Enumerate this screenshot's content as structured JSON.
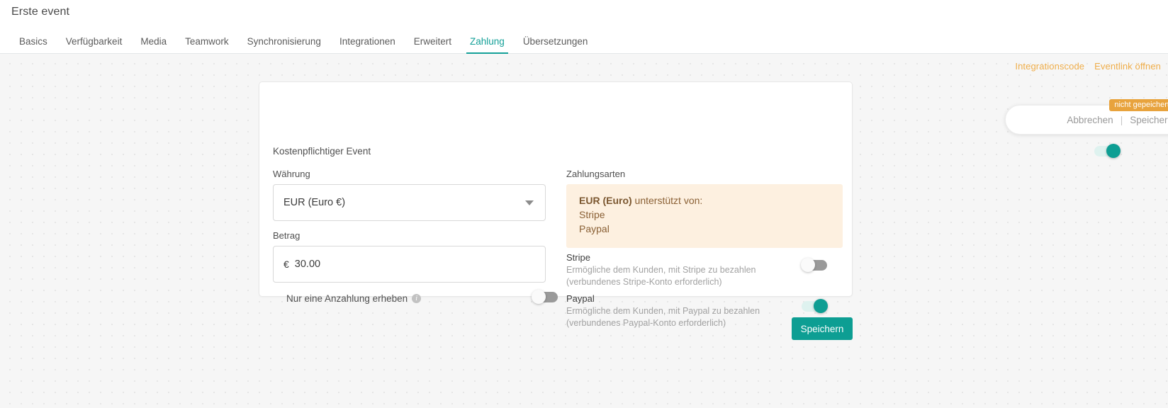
{
  "header": {
    "title": "Erste event",
    "tabs": [
      {
        "label": "Basics",
        "active": false
      },
      {
        "label": "Verfügbarkeit",
        "active": false
      },
      {
        "label": "Media",
        "active": false
      },
      {
        "label": "Teamwork",
        "active": false
      },
      {
        "label": "Synchronisierung",
        "active": false
      },
      {
        "label": "Integrationen",
        "active": false
      },
      {
        "label": "Erweitert",
        "active": false
      },
      {
        "label": "Zahlung",
        "active": true
      },
      {
        "label": "Übersetzungen",
        "active": false
      }
    ]
  },
  "toplinks": {
    "integration_code": "Integrationscode",
    "open_eventlink": "Eventlink öffnen"
  },
  "form": {
    "paid_event_label": "Kostenpflichtiger Event",
    "paid_event_on": true,
    "currency_label": "Währung",
    "currency_value": "EUR (Euro €)",
    "amount_label": "Betrag",
    "amount_symbol": "€",
    "amount_value": "30.00",
    "deposit_label": "Nur eine Anzahlung erheben",
    "deposit_info_icon": "info-icon",
    "deposit_on": false
  },
  "payments": {
    "section_label": "Zahlungsarten",
    "alert": {
      "heading": "EUR (Euro)",
      "heading_suffix": " unterstützt von:",
      "providers": [
        "Stripe",
        "Paypal"
      ]
    },
    "methods": [
      {
        "title": "Stripe",
        "description": "Ermögliche dem Kunden, mit Stripe zu bezahlen (verbundenes Stripe-Konto erforderlich)",
        "enabled": false
      },
      {
        "title": "Paypal",
        "description": "Ermögliche dem Kunden, mit Paypal zu bezahlen (verbundenes Paypal-Konto erforderlich)",
        "enabled": true
      }
    ]
  },
  "actions": {
    "save_label": "Speichern"
  },
  "unsaved": {
    "badge": "nicht gepeichert",
    "cancel_label": "Abbrechen",
    "separator": "|",
    "save_label": "Speichern"
  },
  "colors": {
    "accent_teal": "#0d9e93",
    "link_orange": "#efad49",
    "badge_orange": "#e8a33d",
    "alert_bg": "#fdf0e0",
    "alert_text": "#8a6035"
  }
}
